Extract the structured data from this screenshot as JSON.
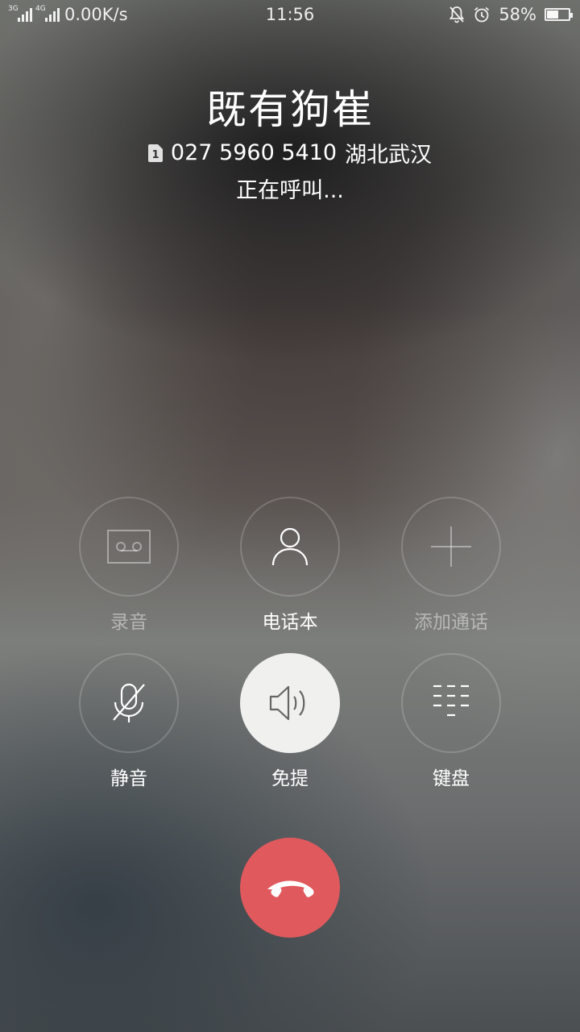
{
  "status_bar": {
    "sim1_network": "3G",
    "sim2_network": "4G",
    "speed": "0.00K/s",
    "time": "11:56",
    "battery_percent": "58%",
    "battery_level": 0.58,
    "icons": [
      "mute-bell-icon",
      "alarm-icon",
      "battery-icon"
    ]
  },
  "caller": {
    "name": "既有狗崔",
    "sim_slot": "1",
    "number": "027 5960 5410",
    "location": "湖北武汉",
    "status": "正在呼叫..."
  },
  "actions": [
    {
      "label": "录音",
      "icon": "record-icon",
      "enabled": false
    },
    {
      "label": "电话本",
      "icon": "contacts-icon",
      "enabled": true
    },
    {
      "label": "添加通话",
      "icon": "add-call-icon",
      "enabled": false
    },
    {
      "label": "静音",
      "icon": "mute-mic-icon",
      "enabled": true
    },
    {
      "label": "免提",
      "icon": "speaker-icon",
      "enabled": true,
      "active": true
    },
    {
      "label": "键盘",
      "icon": "keypad-icon",
      "enabled": true
    }
  ],
  "hangup": {
    "icon": "end-call-icon",
    "color": "#e05a5d"
  }
}
